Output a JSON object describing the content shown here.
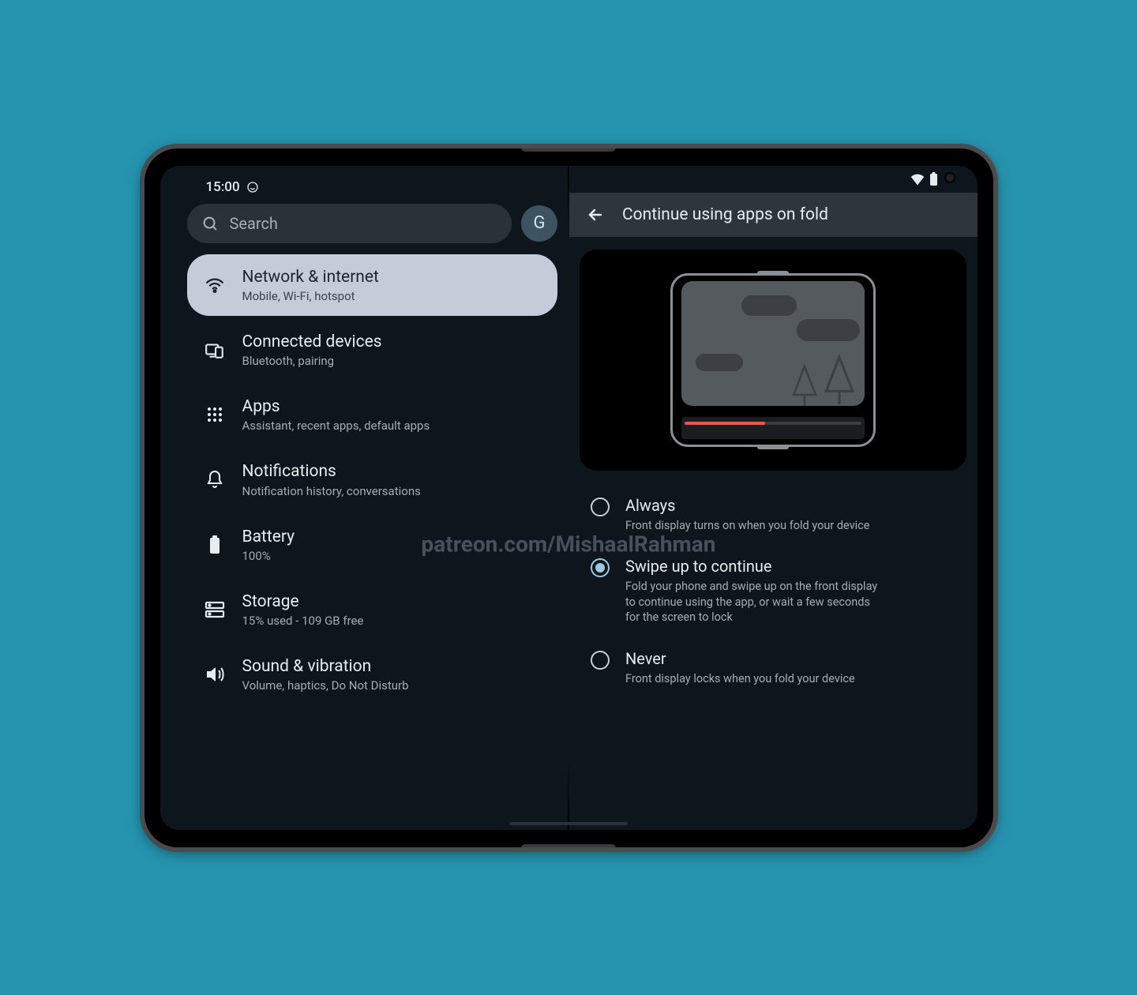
{
  "status_bar": {
    "time": "15:00"
  },
  "left": {
    "search_placeholder": "Search",
    "avatar_letter": "G",
    "settings": [
      {
        "title": "Network & internet",
        "subtitle": "Mobile, Wi-Fi, hotspot",
        "icon": "wifi",
        "selected": true
      },
      {
        "title": "Connected devices",
        "subtitle": "Bluetooth, pairing",
        "icon": "devices",
        "selected": false
      },
      {
        "title": "Apps",
        "subtitle": "Assistant, recent apps, default apps",
        "icon": "apps",
        "selected": false
      },
      {
        "title": "Notifications",
        "subtitle": "Notification history, conversations",
        "icon": "bell",
        "selected": false
      },
      {
        "title": "Battery",
        "subtitle": "100%",
        "icon": "battery",
        "selected": false
      },
      {
        "title": "Storage",
        "subtitle": "15% used - 109 GB free",
        "icon": "storage",
        "selected": false
      },
      {
        "title": "Sound & vibration",
        "subtitle": "Volume, haptics, Do Not Disturb",
        "icon": "sound",
        "selected": false
      }
    ]
  },
  "right": {
    "header_title": "Continue using apps on fold",
    "options": [
      {
        "title": "Always",
        "subtitle": "Front display turns on when you fold your device",
        "selected": false
      },
      {
        "title": "Swipe up to continue",
        "subtitle": "Fold your phone and swipe up on the front display to continue using the app, or wait a few seconds for the screen to lock",
        "selected": true
      },
      {
        "title": "Never",
        "subtitle": "Front display locks when you fold your device",
        "selected": false
      }
    ]
  },
  "watermark": "patreon.com/MishaalRahman"
}
